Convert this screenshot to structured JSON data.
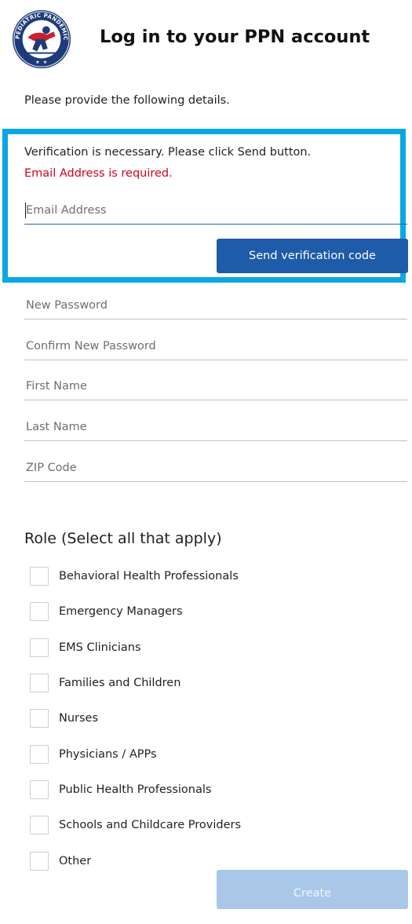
{
  "header": {
    "logo_text": "PEDIATRIC PANDEMIC NETWORK",
    "title": "Log in to your PPN account"
  },
  "intro_text": "Please provide the following details.",
  "verification": {
    "message": "Verification is necessary. Please click Send button.",
    "error": "Email Address is required.",
    "email_placeholder": "Email Address",
    "email_value": "",
    "send_label": "Send verification code"
  },
  "fields": {
    "new_password": "New Password",
    "confirm_password": "Confirm New Password",
    "first_name": "First Name",
    "last_name": "Last Name",
    "zip_code": "ZIP Code"
  },
  "roles": {
    "heading": "Role (Select all that apply)",
    "items": [
      {
        "label": "Behavioral Health Professionals",
        "checked": false
      },
      {
        "label": "Emergency Managers",
        "checked": false
      },
      {
        "label": "EMS Clinicians",
        "checked": false
      },
      {
        "label": "Families and Children",
        "checked": false
      },
      {
        "label": "Nurses",
        "checked": false
      },
      {
        "label": "Physicians / APPs",
        "checked": false
      },
      {
        "label": "Public Health Professionals",
        "checked": false
      },
      {
        "label": "Schools and Childcare Providers",
        "checked": false
      },
      {
        "label": "Other",
        "checked": false
      }
    ]
  },
  "create_label": "Create",
  "colors": {
    "accent_border": "#0aa8e3",
    "primary_button": "#1e5ba8",
    "disabled_button": "#a9c8e8",
    "error": "#d0021b"
  }
}
